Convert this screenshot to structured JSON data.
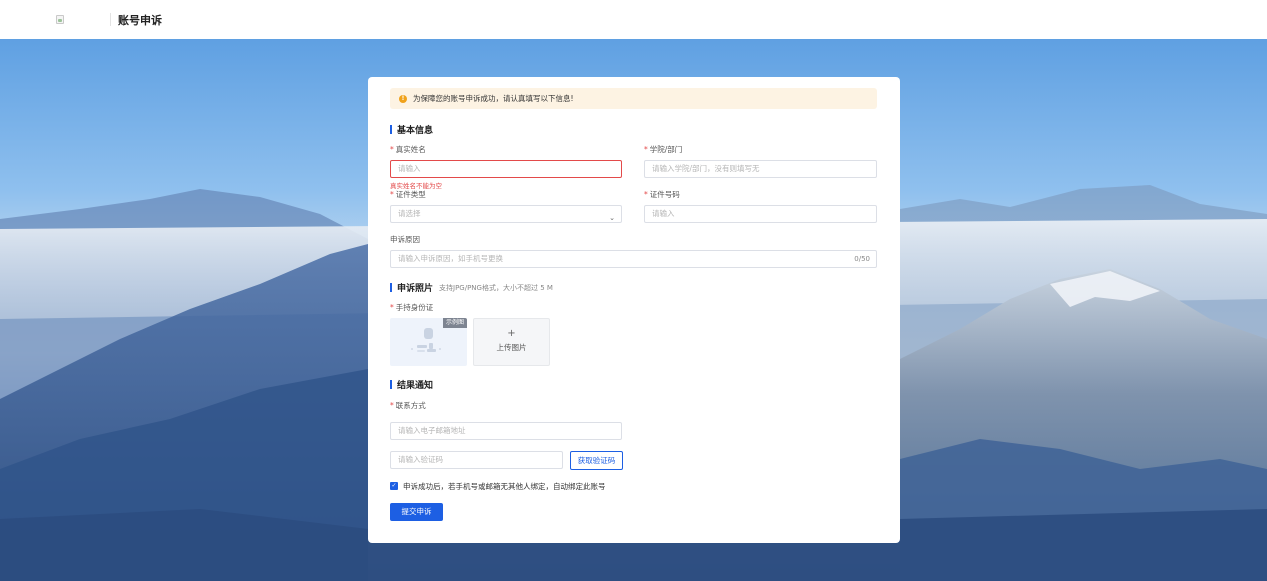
{
  "header": {
    "title": "账号申诉"
  },
  "notice": {
    "text": "为保障您的账号申诉成功，请认真填写以下信息!"
  },
  "sections": {
    "basic": "基本信息",
    "photo": "申诉照片",
    "photo_hint": "支持JPG/PNG格式，大小不超过 5 M",
    "result": "结果通知"
  },
  "form": {
    "name_label": "真实姓名",
    "name_placeholder": "请输入",
    "name_error": "真实姓名不能为空",
    "dept_label": "学院/部门",
    "dept_placeholder": "请输入学院/部门，没有则填写无",
    "id_type_label": "证件类型",
    "id_type_placeholder": "请选择",
    "id_no_label": "证件号码",
    "id_no_placeholder": "请输入",
    "reason_label": "申诉原因",
    "reason_placeholder": "请输入申诉原因，如手机号更换",
    "reason_counter": "0/50",
    "photo_label": "手持身份证",
    "sample_tag": "示例图",
    "upload_plus": "+",
    "upload_label": "上传图片",
    "contact_label": "联系方式",
    "email_placeholder": "请输入电子邮箱地址",
    "code_placeholder": "请输入验证码",
    "get_code": "获取验证码",
    "agree_text": "申诉成功后，若手机号或邮箱无其他人绑定，自动绑定此账号",
    "submit": "提交申诉"
  },
  "icons": {
    "warning": "warning-circle-icon",
    "chevron": "chevron-down-icon",
    "check": "checkbox-checked-icon",
    "broken_image": "broken-image-icon"
  },
  "colors": {
    "primary": "#1d5fe3",
    "error": "#e34a4a",
    "warning": "#f0a21b",
    "notice_bg": "#fdf3e3"
  }
}
